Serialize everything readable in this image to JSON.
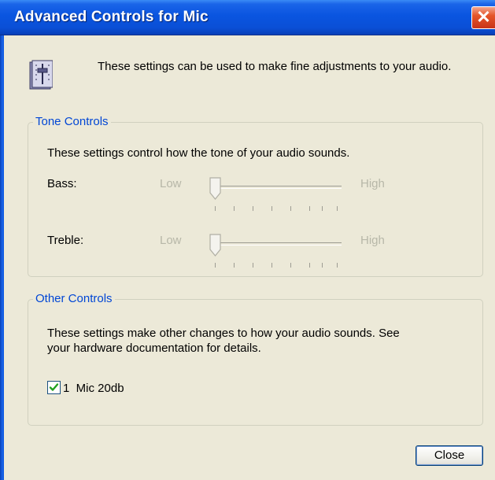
{
  "window": {
    "title": "Advanced Controls for Mic",
    "close_glyph": "✕"
  },
  "header": {
    "icon": "mixer-slider-icon",
    "description": "These settings can be used to make fine adjustments to your audio."
  },
  "tone_controls": {
    "legend": "Tone Controls",
    "description": "These settings control how the tone of your audio sounds.",
    "sliders": [
      {
        "label": "Bass:",
        "low_label": "Low",
        "high_label": "High",
        "value_fraction": 0.0,
        "enabled": false
      },
      {
        "label": "Treble:",
        "low_label": "Low",
        "high_label": "High",
        "value_fraction": 0.0,
        "enabled": false
      }
    ]
  },
  "other_controls": {
    "legend": "Other Controls",
    "description_line1": "These settings make other changes to how your audio sounds.  See",
    "description_line2": "your hardware documentation for details.",
    "checkbox": {
      "label": "1  Mic 20db",
      "checked": true
    }
  },
  "buttons": {
    "close_label": "Close"
  },
  "colors": {
    "title_bar": "#0a55e0",
    "dialog_bg": "#ece9d8",
    "group_legend": "#0046d5",
    "disabled_text": "#b7b7a8",
    "check_mark": "#21a121"
  }
}
